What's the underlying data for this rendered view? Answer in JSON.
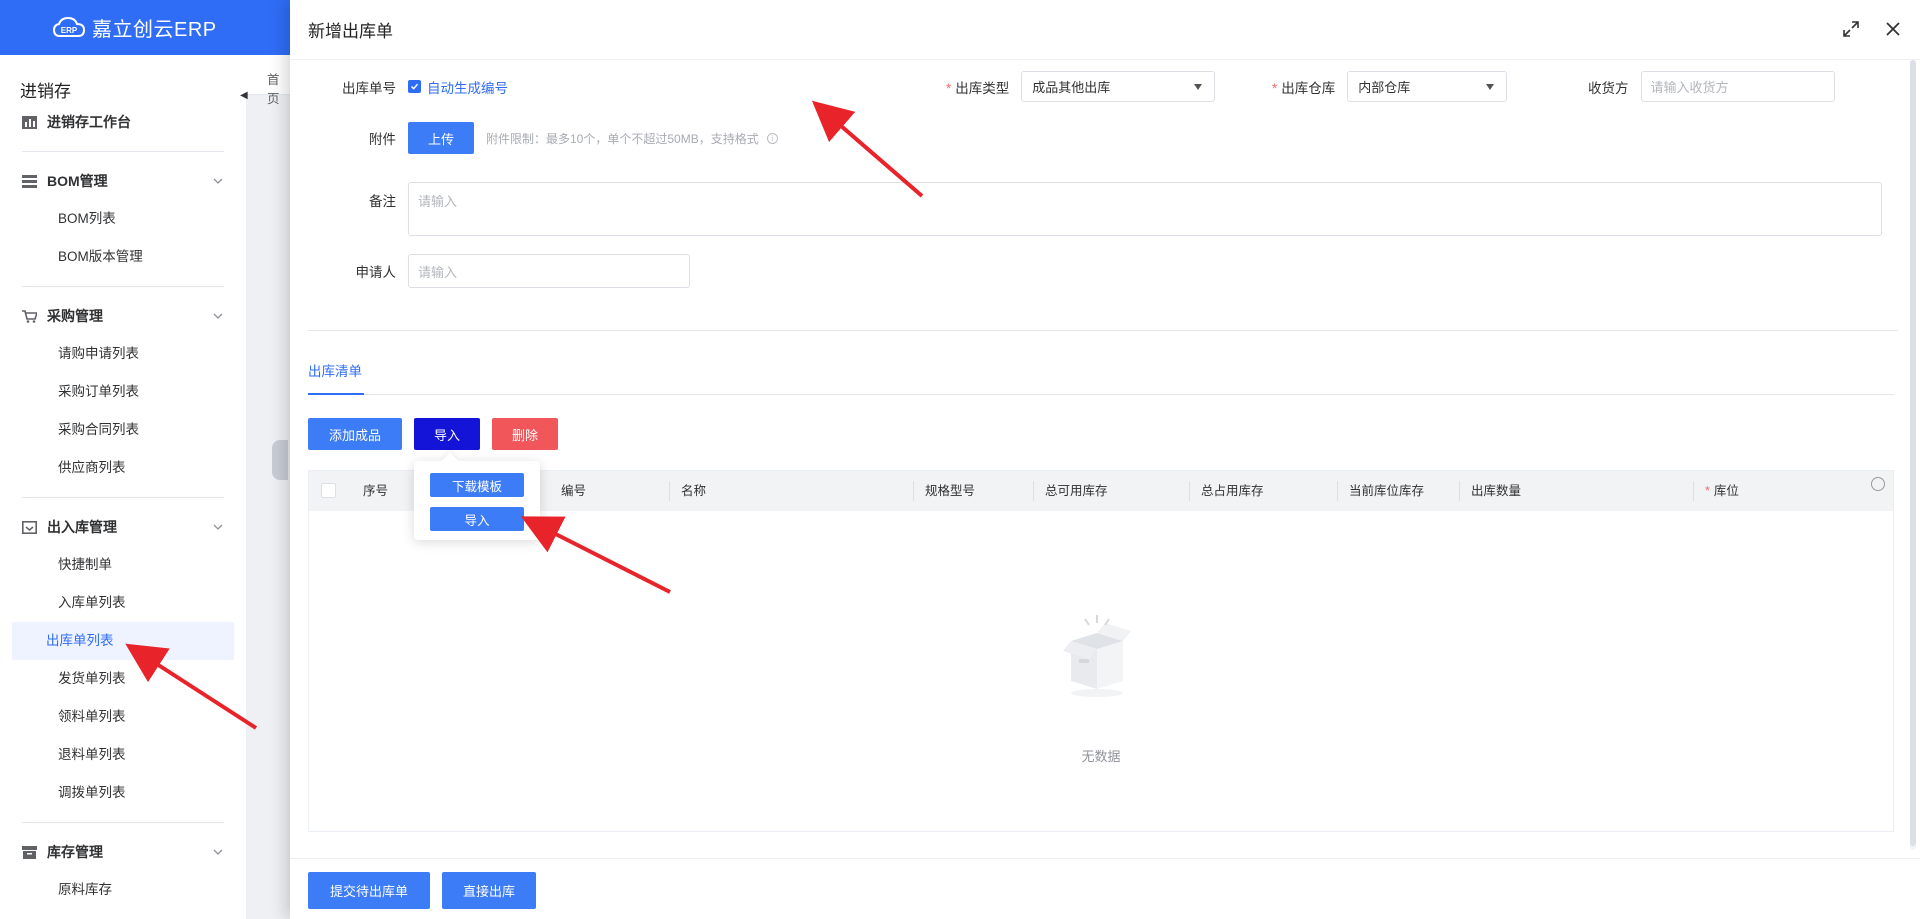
{
  "app": {
    "logo_text": "嘉立创云ERP"
  },
  "sidebar": {
    "title": "进销存",
    "workbench": "进销存工作台",
    "groups": [
      {
        "label": "BOM管理",
        "items": [
          "BOM列表",
          "BOM版本管理"
        ]
      },
      {
        "label": "采购管理",
        "items": [
          "请购申请列表",
          "采购订单列表",
          "采购合同列表",
          "供应商列表"
        ]
      },
      {
        "label": "出入库管理",
        "items": [
          "快捷制单",
          "入库单列表",
          "出库单列表",
          "发货单列表",
          "领料单列表",
          "退料单列表",
          "调拨单列表"
        ]
      },
      {
        "label": "库存管理",
        "items": [
          "原料库存"
        ]
      }
    ],
    "active_item": "出库单列表"
  },
  "background": {
    "breadcrumb_fragment": "首页"
  },
  "dialog": {
    "title": "新增出库单",
    "form": {
      "order_no_label": "出库单号",
      "auto_generate_label": "自动生成编号",
      "auto_generate_checked": true,
      "type_label": "出库类型",
      "type_value": "成品其他出库",
      "warehouse_label": "出库仓库",
      "warehouse_value": "内部仓库",
      "receiver_label": "收货方",
      "receiver_placeholder": "请输入收货方",
      "attachment_label": "附件",
      "upload_label": "上传",
      "upload_hint": "附件限制：最多10个，单个不超过50MB，支持格式",
      "remark_label": "备注",
      "remark_placeholder": "请输入",
      "applicant_label": "申请人",
      "applicant_placeholder": "请输入"
    },
    "tab": "出库清单",
    "toolbar": {
      "add_label": "添加成品",
      "import_label": "导入",
      "delete_label": "删除"
    },
    "import_menu": {
      "download_template": "下载模板",
      "import": "导入"
    },
    "table": {
      "columns": [
        "序号",
        "编号",
        "名称",
        "规格型号",
        "总可用库存",
        "总占用库存",
        "当前库位库存",
        "出库数量",
        "库位"
      ],
      "required_column": "库位",
      "empty_text": "无数据"
    },
    "footer": {
      "submit_pending": "提交待出库单",
      "direct_out": "直接出库"
    }
  },
  "colors": {
    "primary": "#2f6df6",
    "danger": "#f0565a",
    "import_active": "#1414d8",
    "annotation_arrow": "#e8232a"
  }
}
